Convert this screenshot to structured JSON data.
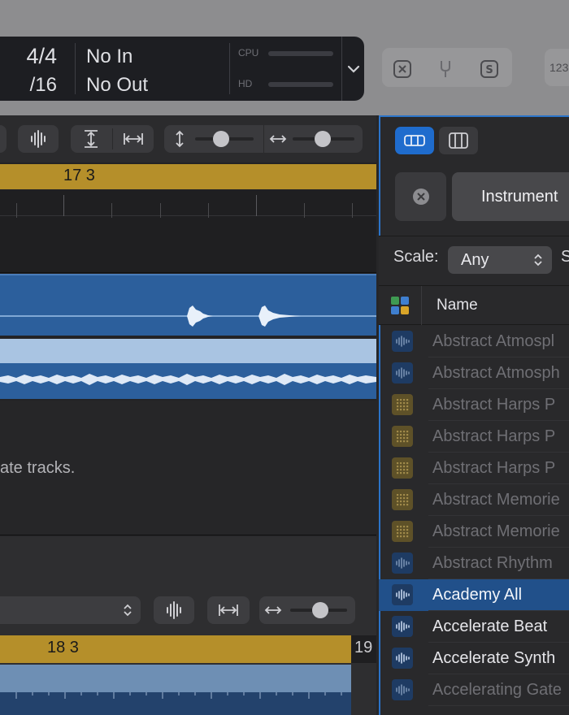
{
  "lcd": {
    "signature": "4/4",
    "division": "/16",
    "input": "No In",
    "output": "No Out",
    "cpu_label": "CPU",
    "hd_label": "HD"
  },
  "toolbar": {
    "number_button": "123"
  },
  "tracks": {
    "ruler_bar": "17 3",
    "empty_hint": "ate tracks.",
    "lower_ruler_bar": "18 3",
    "lower_ruler_end": "19"
  },
  "browser": {
    "instrument_button": "Instrument",
    "scale_label": "Scale:",
    "scale_value": "Any",
    "scale_next_label": "S",
    "name_column": "Name",
    "items": [
      {
        "label": "Abstract Atmospl",
        "icon": "waveform-icon",
        "dim": true
      },
      {
        "label": "Abstract Atmosph",
        "icon": "waveform-icon",
        "dim": true
      },
      {
        "label": "Abstract Harps P",
        "icon": "dots-grid-icon",
        "dim": true
      },
      {
        "label": "Abstract Harps P",
        "icon": "dots-grid-icon",
        "dim": true
      },
      {
        "label": "Abstract Harps P",
        "icon": "dots-grid-icon",
        "dim": true
      },
      {
        "label": "Abstract Memorie",
        "icon": "dots-grid-icon",
        "dim": true
      },
      {
        "label": "Abstract Memorie",
        "icon": "dots-grid-icon",
        "dim": true
      },
      {
        "label": "Abstract Rhythm",
        "icon": "waveform-icon",
        "dim": true
      },
      {
        "label": "Academy All",
        "icon": "waveform-icon",
        "selected": true
      },
      {
        "label": "Accelerate Beat",
        "icon": "waveform-icon"
      },
      {
        "label": "Accelerate Synth",
        "icon": "waveform-icon"
      },
      {
        "label": "Accelerating Gate",
        "icon": "waveform-icon",
        "dim": true
      }
    ]
  },
  "colors": {
    "accent_blue": "#2b74c9",
    "ruler_gold": "#b58f2a",
    "region_blue": "#2c5f9c"
  }
}
